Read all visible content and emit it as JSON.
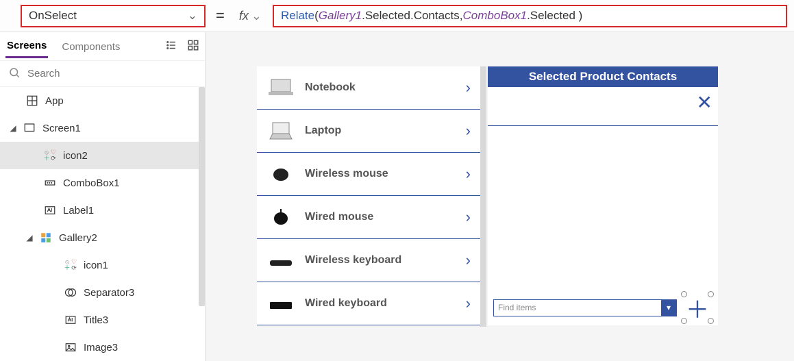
{
  "formula": {
    "property": "OnSelect",
    "equals": "=",
    "fx": "fx",
    "tokens": {
      "fn": "Relate",
      "open": "( ",
      "ident1": "Gallery1",
      "prop1": ".Selected.Contacts, ",
      "ident2": "ComboBox1",
      "prop2": ".Selected )"
    }
  },
  "leftPanel": {
    "tabs": {
      "screens": "Screens",
      "components": "Components"
    },
    "searchPlaceholder": "Search",
    "tree": {
      "app": "App",
      "screen1": "Screen1",
      "icon2": "icon2",
      "combobox1": "ComboBox1",
      "label1": "Label1",
      "gallery2": "Gallery2",
      "icon1": "icon1",
      "separator3": "Separator3",
      "title3": "Title3",
      "image3": "Image3"
    }
  },
  "preview": {
    "gallery": [
      "Notebook",
      "Laptop",
      "Wireless mouse",
      "Wired mouse",
      "Wireless keyboard",
      "Wired keyboard"
    ],
    "rightHeader": "Selected Product Contacts",
    "comboPlaceholder": "Find items"
  }
}
